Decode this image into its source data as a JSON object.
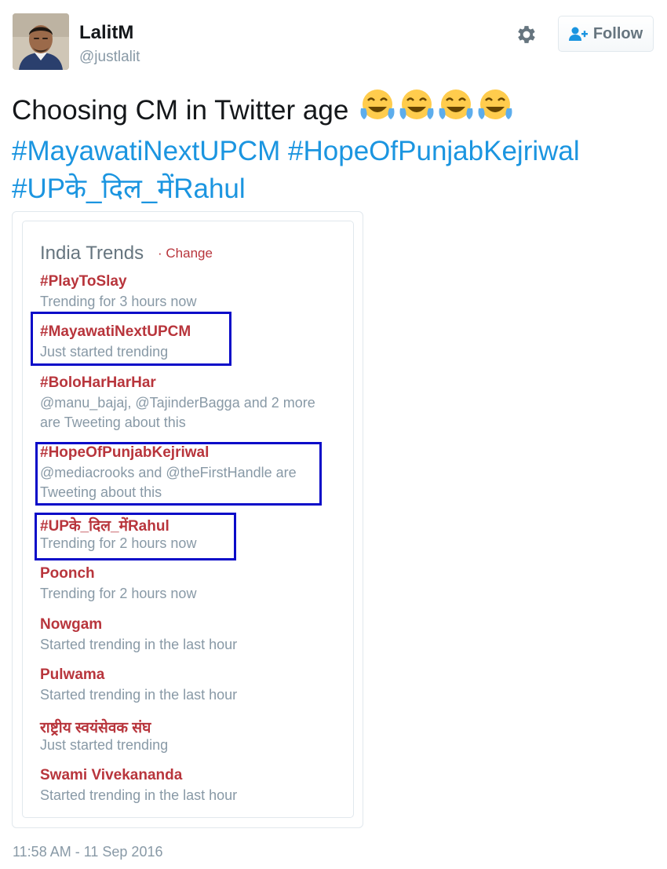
{
  "user": {
    "name": "LalitM",
    "handle": "@justlalit"
  },
  "actions": {
    "follow_label": "Follow"
  },
  "tweet": {
    "text": "Choosing CM in Twitter age",
    "emojis": [
      "😂",
      "😂",
      "😂",
      "😂"
    ],
    "hashtags": [
      "#MayawatiNextUPCM",
      "#HopeOfPunjabKejriwal",
      "#UPके_दिल_मेंRahul"
    ],
    "timestamp": "11:58 AM - 11 Sep 2016"
  },
  "trends": {
    "title": "India Trends",
    "change_label": "· Change",
    "items": [
      {
        "name": "#PlayToSlay",
        "desc": [
          "Trending for 3 hours now"
        ]
      },
      {
        "name": "#MayawatiNextUPCM",
        "desc": [
          "Just started trending"
        ]
      },
      {
        "name": "#BoloHarHarHar",
        "desc": [
          "@manu_bajaj, @TajinderBagga and 2 more",
          "are Tweeting about this"
        ]
      },
      {
        "name": "#HopeOfPunjabKejriwal",
        "desc": [
          "@mediacrooks and @theFirstHandle are",
          "Tweeting about this"
        ]
      },
      {
        "name": "#UPके_दिल_मेंRahul",
        "desc": [
          "Trending for 2 hours now"
        ]
      },
      {
        "name": "Poonch",
        "desc": [
          "Trending for 2 hours now"
        ]
      },
      {
        "name": "Nowgam",
        "desc": [
          "Started trending in the last hour"
        ]
      },
      {
        "name": "Pulwama",
        "desc": [
          "Started trending in the last hour"
        ]
      },
      {
        "name": "राष्ट्रीय स्वयंसेवक संघ",
        "desc": [
          "Just started trending"
        ]
      },
      {
        "name": "Swami Vivekananda",
        "desc": [
          "Started trending in the last hour"
        ]
      }
    ]
  },
  "colors": {
    "hashtag_blue": "#1b95e0",
    "trend_red": "#b8353c",
    "muted_gray": "#8899a6",
    "highlight_box": "#0b0bc8"
  }
}
